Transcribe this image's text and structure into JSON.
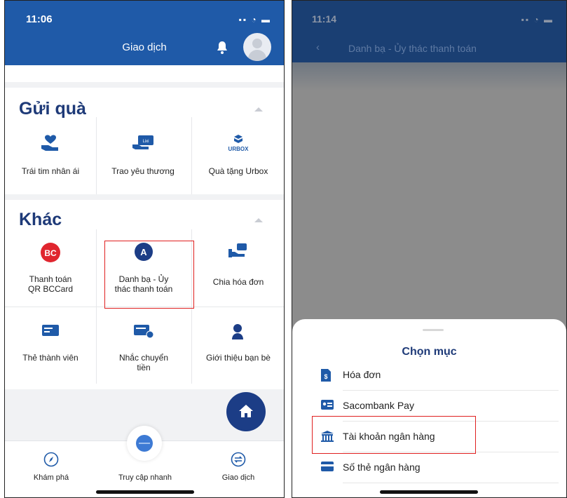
{
  "left_screen": {
    "status_time": "11:06",
    "header_title": "Giao dịch",
    "gift_section": {
      "title": "Gửi quà",
      "items": [
        {
          "label": "Trái tim nhân ái"
        },
        {
          "label": "Trao yêu thương",
          "icon_text": "Lixi"
        },
        {
          "label": "Quà tặng Urbox",
          "icon_text": "URBOX"
        }
      ]
    },
    "other_section": {
      "title": "Khác",
      "items": [
        {
          "label1": "Thanh toán",
          "label2": "QR BCCard",
          "icon_text": "BC"
        },
        {
          "label1": "Danh bạ - Ủy",
          "label2": "thác thanh toán",
          "icon_text": "A"
        },
        {
          "label1": "Chia hóa đơn",
          "label2": ""
        },
        {
          "label1": "Thẻ thành viên",
          "label2": ""
        },
        {
          "label1": "Nhắc chuyển",
          "label2": "tiền"
        },
        {
          "label1": "Giới thiệu bạn bè",
          "label2": ""
        }
      ]
    },
    "bottom_nav": {
      "explore": "Khám phá",
      "quick_access": "Truy cập nhanh",
      "transactions": "Giao dịch"
    }
  },
  "right_screen": {
    "status_time": "11:14",
    "header_title": "Danh bạ - Ủy thác thanh toán",
    "sheet_title": "Chọn mục",
    "options": [
      "Hóa đơn",
      "Sacombank Pay",
      "Tài khoản ngân hàng",
      "Số thẻ ngân hàng"
    ]
  },
  "colors": {
    "primary": "#1f5aa8",
    "navy": "#1e3a78",
    "highlight": "#e02020"
  }
}
